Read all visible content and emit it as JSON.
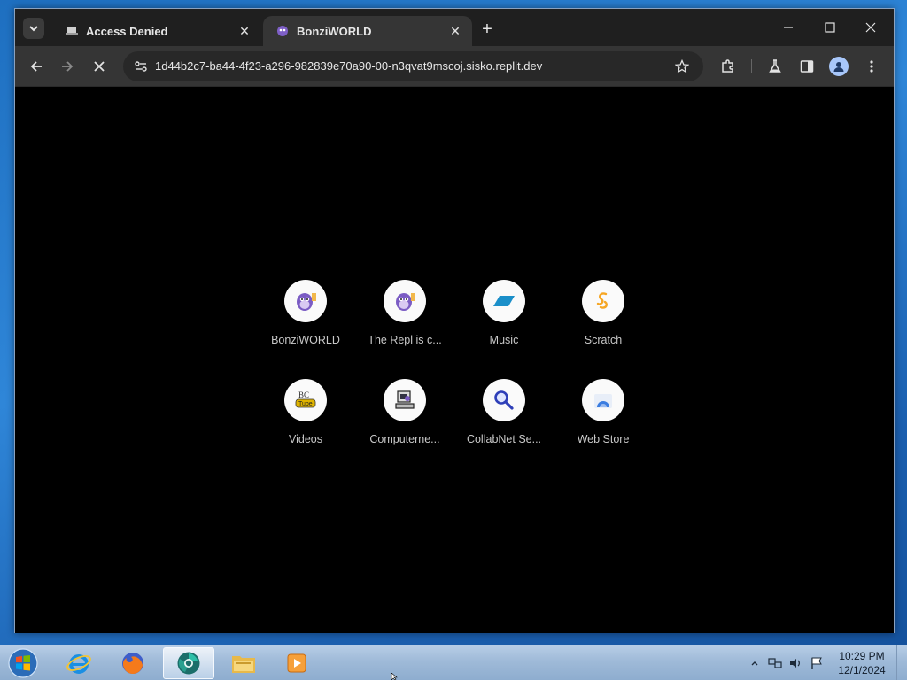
{
  "browser": {
    "tabs": [
      {
        "title": "Access Denied",
        "active": false
      },
      {
        "title": "BonziWORLD",
        "active": true
      }
    ],
    "url": "1d44b2c7-ba44-4f23-a296-982839e70a90-00-n3qvat9mscoj.sisko.replit.dev",
    "accent_color": "#a8c7fa"
  },
  "shortcuts": [
    {
      "label": "BonziWORLD",
      "icon": "bonzi-icon"
    },
    {
      "label": "The Repl is c...",
      "icon": "bonzi-icon"
    },
    {
      "label": "Music",
      "icon": "music-parallelogram-icon"
    },
    {
      "label": "Scratch",
      "icon": "scratch-icon"
    },
    {
      "label": "Videos",
      "icon": "bc-tube-icon"
    },
    {
      "label": "Computerne...",
      "icon": "computer-icon"
    },
    {
      "label": "CollabNet Se...",
      "icon": "search-magnifier-icon"
    },
    {
      "label": "Web Store",
      "icon": "web-store-icon"
    }
  ],
  "taskbar": {
    "apps": [
      "internet-explorer-icon",
      "firefox-icon",
      "browser-icon",
      "file-explorer-icon",
      "media-player-icon"
    ],
    "time": "10:29 PM",
    "date": "12/1/2024"
  }
}
